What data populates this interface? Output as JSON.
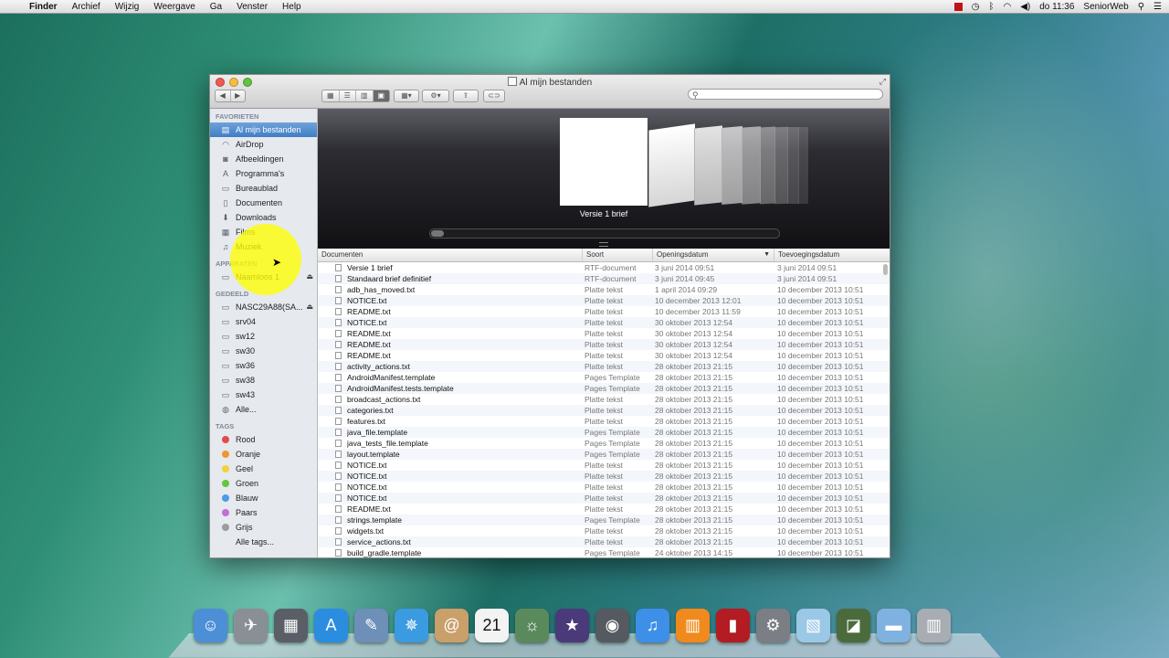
{
  "menubar": {
    "apple": "",
    "items": [
      "Finder",
      "Archief",
      "Wijzig",
      "Weergave",
      "Ga",
      "Venster",
      "Help"
    ],
    "clock": "do 11:36",
    "user": "SeniorWeb"
  },
  "window": {
    "title": "Al mijn bestanden"
  },
  "sidebar": {
    "favorites_header": "FAVORIETEN",
    "favorites": [
      {
        "label": "Al mijn bestanden",
        "icon": "all-files-icon",
        "glyph": "▤"
      },
      {
        "label": "AirDrop",
        "icon": "airdrop-icon",
        "glyph": "◠"
      },
      {
        "label": "Afbeeldingen",
        "icon": "camera-icon",
        "glyph": "◙"
      },
      {
        "label": "Programma's",
        "icon": "applications-icon",
        "glyph": "A"
      },
      {
        "label": "Bureaublad",
        "icon": "desktop-icon",
        "glyph": "▭"
      },
      {
        "label": "Documenten",
        "icon": "documents-icon",
        "glyph": "▯"
      },
      {
        "label": "Downloads",
        "icon": "downloads-icon",
        "glyph": "⬇"
      },
      {
        "label": "Films",
        "icon": "movies-icon",
        "glyph": "▦"
      },
      {
        "label": "Muziek",
        "icon": "music-icon",
        "glyph": "♫"
      }
    ],
    "devices_header": "APPARATEN",
    "devices": [
      {
        "label": "Naamloos 1",
        "icon": "disk-icon",
        "glyph": "▭"
      }
    ],
    "shared_header": "GEDEELD",
    "shared": [
      {
        "label": "NASC29A88(SA...",
        "icon": "server-icon",
        "glyph": "▭"
      },
      {
        "label": "srv04",
        "icon": "server-icon",
        "glyph": "▭"
      },
      {
        "label": "sw12",
        "icon": "server-icon",
        "glyph": "▭"
      },
      {
        "label": "sw30",
        "icon": "server-icon",
        "glyph": "▭"
      },
      {
        "label": "sw36",
        "icon": "server-icon",
        "glyph": "▭"
      },
      {
        "label": "sw38",
        "icon": "server-icon",
        "glyph": "▭"
      },
      {
        "label": "sw43",
        "icon": "server-icon",
        "glyph": "▭"
      },
      {
        "label": "Alle...",
        "icon": "network-icon",
        "glyph": "◍"
      }
    ],
    "tags_header": "TAGS",
    "tags": [
      {
        "label": "Rood",
        "color": "#e24b4b"
      },
      {
        "label": "Oranje",
        "color": "#f0962e"
      },
      {
        "label": "Geel",
        "color": "#f3d23a"
      },
      {
        "label": "Groen",
        "color": "#63c540"
      },
      {
        "label": "Blauw",
        "color": "#4a9be8"
      },
      {
        "label": "Paars",
        "color": "#c36fd6"
      },
      {
        "label": "Grijs",
        "color": "#9c9c9c"
      },
      {
        "label": "Alle tags...",
        "color": "#e6e9ee"
      }
    ]
  },
  "coverflow": {
    "selected_label": "Versie 1 brief"
  },
  "columns": {
    "name": "Documenten",
    "kind": "Soort",
    "opened": "Openingsdatum",
    "added": "Toevoegingsdatum"
  },
  "files": [
    {
      "name": "Versie 1 brief",
      "kind": "RTF-document",
      "opened": "3 juni 2014 09:51",
      "added": "3 juni 2014 09:51"
    },
    {
      "name": "Standaard brief definitief",
      "kind": "RTF-document",
      "opened": "3 juni 2014 09:45",
      "added": "3 juni 2014 09:51"
    },
    {
      "name": "adb_has_moved.txt",
      "kind": "Platte tekst",
      "opened": "1 april 2014 09:29",
      "added": "10 december 2013 10:51"
    },
    {
      "name": "NOTICE.txt",
      "kind": "Platte tekst",
      "opened": "10 december 2013 12:01",
      "added": "10 december 2013 10:51"
    },
    {
      "name": "README.txt",
      "kind": "Platte tekst",
      "opened": "10 december 2013 11:59",
      "added": "10 december 2013 10:51"
    },
    {
      "name": "NOTICE.txt",
      "kind": "Platte tekst",
      "opened": "30 oktober 2013 12:54",
      "added": "10 december 2013 10:51"
    },
    {
      "name": "README.txt",
      "kind": "Platte tekst",
      "opened": "30 oktober 2013 12:54",
      "added": "10 december 2013 10:51"
    },
    {
      "name": "README.txt",
      "kind": "Platte tekst",
      "opened": "30 oktober 2013 12:54",
      "added": "10 december 2013 10:51"
    },
    {
      "name": "README.txt",
      "kind": "Platte tekst",
      "opened": "30 oktober 2013 12:54",
      "added": "10 december 2013 10:51"
    },
    {
      "name": "activity_actions.txt",
      "kind": "Platte tekst",
      "opened": "28 oktober 2013 21:15",
      "added": "10 december 2013 10:51"
    },
    {
      "name": "AndroidManifest.template",
      "kind": "Pages Template",
      "opened": "28 oktober 2013 21:15",
      "added": "10 december 2013 10:51"
    },
    {
      "name": "AndroidManifest.tests.template",
      "kind": "Pages Template",
      "opened": "28 oktober 2013 21:15",
      "added": "10 december 2013 10:51"
    },
    {
      "name": "broadcast_actions.txt",
      "kind": "Platte tekst",
      "opened": "28 oktober 2013 21:15",
      "added": "10 december 2013 10:51"
    },
    {
      "name": "categories.txt",
      "kind": "Platte tekst",
      "opened": "28 oktober 2013 21:15",
      "added": "10 december 2013 10:51"
    },
    {
      "name": "features.txt",
      "kind": "Platte tekst",
      "opened": "28 oktober 2013 21:15",
      "added": "10 december 2013 10:51"
    },
    {
      "name": "java_file.template",
      "kind": "Pages Template",
      "opened": "28 oktober 2013 21:15",
      "added": "10 december 2013 10:51"
    },
    {
      "name": "java_tests_file.template",
      "kind": "Pages Template",
      "opened": "28 oktober 2013 21:15",
      "added": "10 december 2013 10:51"
    },
    {
      "name": "layout.template",
      "kind": "Pages Template",
      "opened": "28 oktober 2013 21:15",
      "added": "10 december 2013 10:51"
    },
    {
      "name": "NOTICE.txt",
      "kind": "Platte tekst",
      "opened": "28 oktober 2013 21:15",
      "added": "10 december 2013 10:51"
    },
    {
      "name": "NOTICE.txt",
      "kind": "Platte tekst",
      "opened": "28 oktober 2013 21:15",
      "added": "10 december 2013 10:51"
    },
    {
      "name": "NOTICE.txt",
      "kind": "Platte tekst",
      "opened": "28 oktober 2013 21:15",
      "added": "10 december 2013 10:51"
    },
    {
      "name": "NOTICE.txt",
      "kind": "Platte tekst",
      "opened": "28 oktober 2013 21:15",
      "added": "10 december 2013 10:51"
    },
    {
      "name": "README.txt",
      "kind": "Platte tekst",
      "opened": "28 oktober 2013 21:15",
      "added": "10 december 2013 10:51"
    },
    {
      "name": "strings.template",
      "kind": "Pages Template",
      "opened": "28 oktober 2013 21:15",
      "added": "10 december 2013 10:51"
    },
    {
      "name": "widgets.txt",
      "kind": "Platte tekst",
      "opened": "28 oktober 2013 21:15",
      "added": "10 december 2013 10:51"
    },
    {
      "name": "service_actions.txt",
      "kind": "Platte tekst",
      "opened": "28 oktober 2013 21:15",
      "added": "10 december 2013 10:51"
    },
    {
      "name": "build_gradle.template",
      "kind": "Pages Template",
      "opened": "24 oktober 2013 14:15",
      "added": "10 december 2013 10:51"
    }
  ],
  "dock": [
    {
      "name": "finder-icon",
      "color": "#4d8fd6",
      "glyph": "☺"
    },
    {
      "name": "launchpad-icon",
      "color": "#8a8f96",
      "glyph": "✈"
    },
    {
      "name": "mission-control-icon",
      "color": "#5a5e66",
      "glyph": "▦"
    },
    {
      "name": "app-store-icon",
      "color": "#2b8de0",
      "glyph": "A"
    },
    {
      "name": "preview-icon",
      "color": "#6e8fb8",
      "glyph": "✎"
    },
    {
      "name": "safari-icon",
      "color": "#3b9be0",
      "glyph": "✵"
    },
    {
      "name": "contacts-icon",
      "color": "#c9a06a",
      "glyph": "@"
    },
    {
      "name": "calendar-icon",
      "color": "#f3f3f3",
      "glyph": "21"
    },
    {
      "name": "iphoto-icon",
      "color": "#5a8a5c",
      "glyph": "☼"
    },
    {
      "name": "imovie-icon",
      "color": "#4a3a7a",
      "glyph": "★"
    },
    {
      "name": "facetime-icon",
      "color": "#555a60",
      "glyph": "◉"
    },
    {
      "name": "itunes-icon",
      "color": "#3d8fe8",
      "glyph": "♫"
    },
    {
      "name": "ibooks-icon",
      "color": "#f08a1c",
      "glyph": "▥"
    },
    {
      "name": "photo-booth-icon",
      "color": "#b21c22",
      "glyph": "▮"
    },
    {
      "name": "system-preferences-icon",
      "color": "#7b7e84",
      "glyph": "⚙"
    },
    {
      "name": "maps-icon",
      "color": "#9bc8e6",
      "glyph": "▧"
    },
    {
      "name": "dashboard-icon",
      "color": "#4b6b3c",
      "glyph": "◪"
    },
    {
      "name": "folder-icon",
      "color": "#7fb2e0",
      "glyph": "▬"
    },
    {
      "name": "trash-icon",
      "color": "#a8adb3",
      "glyph": "▥"
    }
  ]
}
